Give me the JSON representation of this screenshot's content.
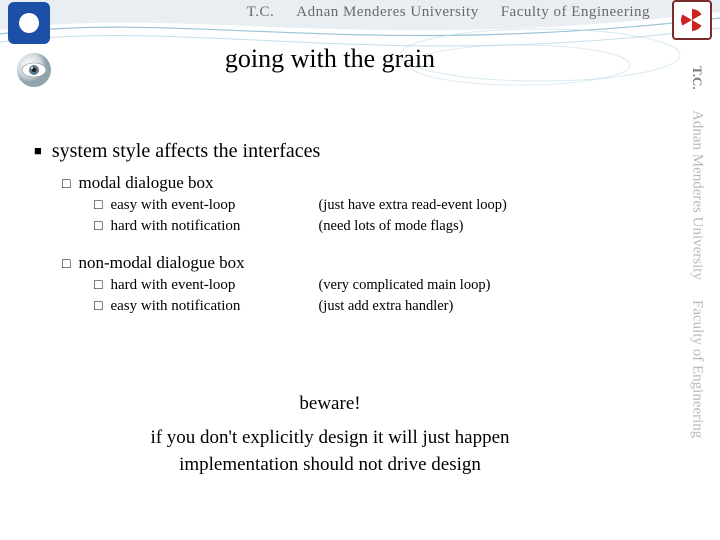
{
  "header": {
    "tc": "T.C.",
    "university": "Adnan Menderes University",
    "faculty": "Faculty of Engineering"
  },
  "title": "going with the grain",
  "main": {
    "heading": "system style affects the interfaces",
    "sections": [
      {
        "label": "modal dialogue box",
        "rows": [
          {
            "text": "easy with event-loop",
            "note": "(just have extra read-event loop)"
          },
          {
            "text": "hard with notification",
            "note": "(need lots of mode flags)"
          }
        ]
      },
      {
        "label": "non-modal dialogue box",
        "rows": [
          {
            "text": "hard with event-loop",
            "note": "(very complicated main loop)"
          },
          {
            "text": "easy with notification",
            "note": "(just add extra handler)"
          }
        ]
      }
    ]
  },
  "footer": {
    "beware": "beware!",
    "line1": "if you don't explicitly design it will just happen",
    "line2": "implementation should not drive design"
  },
  "sidebar": {
    "tc": "T.C.",
    "university": "Adnan Menderes University",
    "faculty": "Faculty of Engineering"
  }
}
